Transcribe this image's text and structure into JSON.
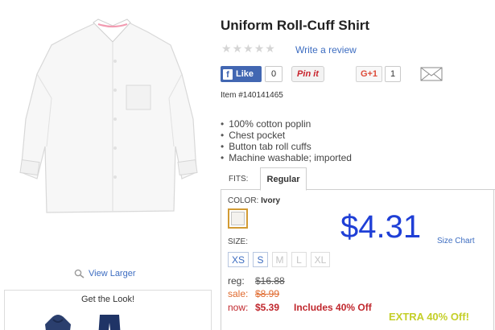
{
  "product": {
    "title": "Uniform Roll-Cuff Shirt",
    "item_number": "Item #140141465",
    "view_larger": "View Larger",
    "features": [
      "100% cotton poplin",
      "Chest pocket",
      "Button tab roll cuffs",
      "Machine washable; imported"
    ]
  },
  "rating": {
    "stars_filled": 0,
    "stars_total": 5,
    "write_review": "Write a review"
  },
  "social": {
    "facebook_label": "Like",
    "facebook_count": "0",
    "pinterest_label": "Pin it",
    "gplus_label": "G+1",
    "gplus_count": "1",
    "email_icon": "envelope-icon"
  },
  "fits": {
    "label": "FITS:",
    "tabs": [
      "Regular"
    ],
    "selected": "Regular"
  },
  "color": {
    "label": "COLOR:",
    "selected": "Ivory",
    "swatch_hex": "#f4f2ee"
  },
  "price": {
    "display": "$4.31",
    "reg_label": "reg:",
    "reg_value": "$16.88",
    "sale_label": "sale:",
    "sale_value": "$8.99",
    "now_label": "now:",
    "now_value": "$5.39",
    "now_note": "Includes 40% Off",
    "extra_promo": "EXTRA 40% Off!"
  },
  "size": {
    "label": "SIZE:",
    "chart_link": "Size Chart",
    "options": [
      {
        "label": "XS",
        "available": true
      },
      {
        "label": "S",
        "available": true
      },
      {
        "label": "M",
        "available": false
      },
      {
        "label": "L",
        "available": false
      },
      {
        "label": "XL",
        "available": false
      }
    ]
  },
  "get_the_look": {
    "title": "Get the Look!"
  },
  "colors": {
    "link": "#3d6dc1",
    "price_blue": "#1f3fd6",
    "sale_orange": "#e06a2e",
    "now_red": "#c0272d",
    "promo_green": "#c4cf28",
    "facebook": "#4267b2"
  }
}
